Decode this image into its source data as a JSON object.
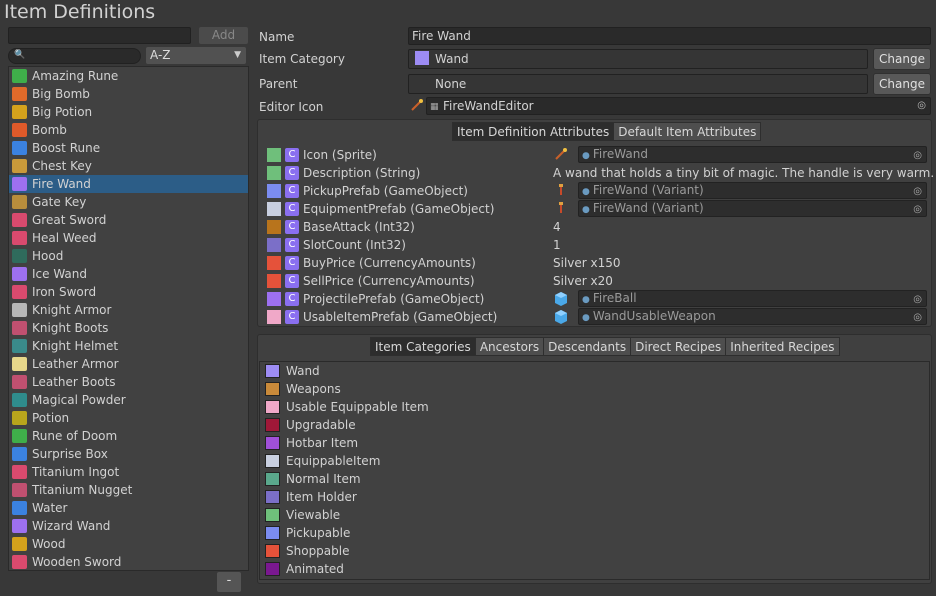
{
  "window": {
    "title": "Item Definitions"
  },
  "left": {
    "add_label": "Add",
    "new_item_value": "",
    "search_value": "",
    "sort_selected": "A-Z",
    "remove_label": "-",
    "items": [
      {
        "label": "Amazing Rune",
        "icon_color": "#3fae4a"
      },
      {
        "label": "Big Bomb",
        "icon_color": "#e06a2a"
      },
      {
        "label": "Big Potion",
        "icon_color": "#d4a21c"
      },
      {
        "label": "Bomb",
        "icon_color": "#e05a2a"
      },
      {
        "label": "Boost Rune",
        "icon_color": "#3b82e0"
      },
      {
        "label": "Chest Key",
        "icon_color": "#c99a3a"
      },
      {
        "label": "Fire Wand",
        "icon_color": "#9d70f0"
      },
      {
        "label": "Gate Key",
        "icon_color": "#b88d3c"
      },
      {
        "label": "Great Sword",
        "icon_color": "#d94a6e"
      },
      {
        "label": "Heal Weed",
        "icon_color": "#d94a6e"
      },
      {
        "label": "Hood",
        "icon_color": "#2f6b5c"
      },
      {
        "label": "Ice Wand",
        "icon_color": "#9d70f0"
      },
      {
        "label": "Iron Sword",
        "icon_color": "#d94a6e"
      },
      {
        "label": "Knight Armor",
        "icon_color": "#b7b7b7"
      },
      {
        "label": "Knight Boots",
        "icon_color": "#c05070"
      },
      {
        "label": "Knight Helmet",
        "icon_color": "#3a8a8a"
      },
      {
        "label": "Leather Armor",
        "icon_color": "#e7d78a"
      },
      {
        "label": "Leather Boots",
        "icon_color": "#c05070"
      },
      {
        "label": "Magical Powder",
        "icon_color": "#2f8c8c"
      },
      {
        "label": "Potion",
        "icon_color": "#b8a51c"
      },
      {
        "label": "Rune of Doom",
        "icon_color": "#3fae4a"
      },
      {
        "label": "Surprise Box",
        "icon_color": "#3b82e0"
      },
      {
        "label": "Titanium Ingot",
        "icon_color": "#d94a6e"
      },
      {
        "label": "Titanium Nugget",
        "icon_color": "#c05070"
      },
      {
        "label": "Water",
        "icon_color": "#3b82e0"
      },
      {
        "label": "Wizard Wand",
        "icon_color": "#9d70f0"
      },
      {
        "label": "Wood",
        "icon_color": "#d4a21c"
      },
      {
        "label": "Wooden Sword",
        "icon_color": "#d94a6e"
      }
    ],
    "selected_index": 6
  },
  "form": {
    "name_label": "Name",
    "name_value": "Fire Wand",
    "category_label": "Item Category",
    "category_value": "Wand",
    "category_color": "#9d8cf4",
    "change_label": "Change",
    "parent_label": "Parent",
    "parent_value": "None",
    "parent_change_label": "Change",
    "editor_icon_label": "Editor Icon",
    "editor_icon_value": "FireWandEditor"
  },
  "attributes": {
    "tabs": [
      {
        "label": "Item Definition Attributes",
        "active": true
      },
      {
        "label": "Default Item Attributes",
        "active": false
      }
    ],
    "rows": [
      {
        "name": "Icon (Sprite)",
        "color": "#6fbf7b",
        "kind": "object",
        "value": "FireWand",
        "icon": "wand-icon"
      },
      {
        "name": "Description (String)",
        "color": "#6fbf7b",
        "kind": "text",
        "value": "A wand that holds a tiny bit of magic. The handle is very warm."
      },
      {
        "name": "PickupPrefab (GameObject)",
        "color": "#7b8cf0",
        "kind": "object",
        "value": "FireWand (Variant)",
        "icon": "prefab-icon"
      },
      {
        "name": "EquipmentPrefab (GameObject)",
        "color": "#c8cfe0",
        "kind": "object",
        "value": "FireWand (Variant)",
        "icon": "prefab-icon"
      },
      {
        "name": "BaseAttack (Int32)",
        "color": "#b8741c",
        "kind": "text",
        "value": "4"
      },
      {
        "name": "SlotCount (Int32)",
        "color": "#7b6fc8",
        "kind": "text",
        "value": "1"
      },
      {
        "name": "BuyPrice (CurrencyAmounts)",
        "color": "#e5523a",
        "kind": "text",
        "value": "Silver x150"
      },
      {
        "name": "SellPrice (CurrencyAmounts)",
        "color": "#e5523a",
        "kind": "text",
        "value": "Silver x20"
      },
      {
        "name": "ProjectilePrefab (GameObject)",
        "color": "#9d70f0",
        "kind": "object",
        "value": "FireBall",
        "icon": "cube-icon"
      },
      {
        "name": "UsableItemPrefab (GameObject)",
        "color": "#f0a8c8",
        "kind": "object",
        "value": "WandUsableWeapon",
        "icon": "cube-icon"
      }
    ],
    "c_label": "C"
  },
  "categories": {
    "tabs": [
      {
        "label": "Item Categories",
        "active": true
      },
      {
        "label": "Ancestors",
        "active": false
      },
      {
        "label": "Descendants",
        "active": false
      },
      {
        "label": "Direct Recipes",
        "active": false
      },
      {
        "label": "Inherited Recipes",
        "active": false
      }
    ],
    "items": [
      {
        "label": "Wand",
        "color": "#9d8cf4"
      },
      {
        "label": "Weapons",
        "color": "#c98a3a"
      },
      {
        "label": "Usable Equippable Item",
        "color": "#f0a8c8"
      },
      {
        "label": "Upgradable",
        "color": "#a01838"
      },
      {
        "label": "Hotbar Item",
        "color": "#a050d8"
      },
      {
        "label": "EquippableItem",
        "color": "#c8cfe0"
      },
      {
        "label": "Normal Item",
        "color": "#5aa88c"
      },
      {
        "label": "Item Holder",
        "color": "#7b6fc8"
      },
      {
        "label": "Viewable",
        "color": "#6fbf7b"
      },
      {
        "label": "Pickupable",
        "color": "#7b8cf0"
      },
      {
        "label": "Shoppable",
        "color": "#e5523a"
      },
      {
        "label": "Animated",
        "color": "#7a1890"
      }
    ]
  }
}
